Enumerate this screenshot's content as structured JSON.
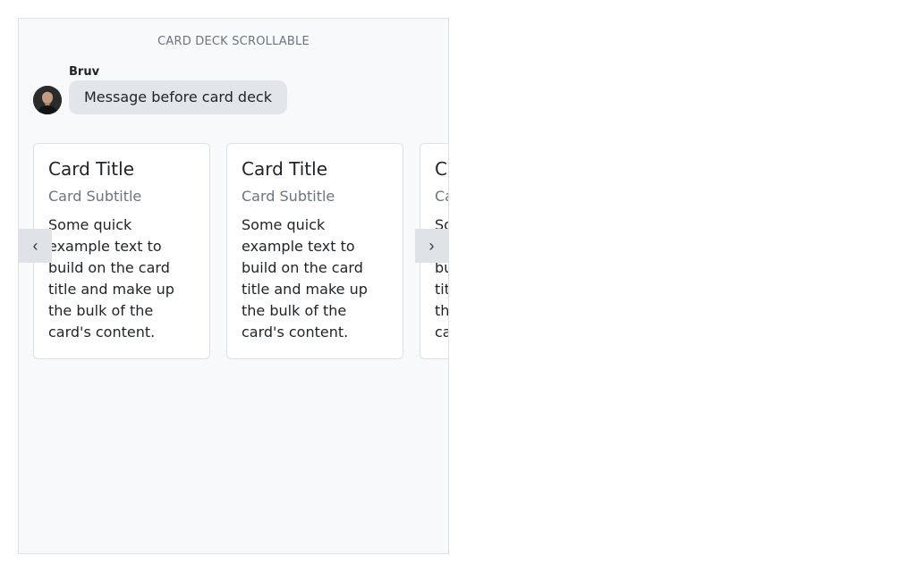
{
  "panel": {
    "title": "CARD DECK SCROLLABLE"
  },
  "message": {
    "sender": "Bruv",
    "avatar_icon": "user-avatar-photo",
    "text": "Message before card deck"
  },
  "deck": {
    "prev_icon": "chevron-left-icon",
    "prev_glyph": "‹",
    "next_icon": "chevron-right-icon",
    "next_glyph": "›",
    "cards": [
      {
        "title": "Card Title",
        "subtitle": "Card Subtitle",
        "text": "Some quick example text to build on the card title and make up the bulk of the card's content."
      },
      {
        "title": "Card Title",
        "subtitle": "Card Subtitle",
        "text": "Some quick example text to build on the card title and make up the bulk of the card's content."
      },
      {
        "title": "Card Title",
        "subtitle": "Card Subtitle",
        "text": "Some quick example text to build on the card title and make up the bulk of the card's content."
      }
    ]
  },
  "colors": {
    "panel_bg": "#f8f9fa",
    "bubble_bg": "#e2e5e9",
    "muted_text": "#6c757d",
    "body_text": "#212529",
    "card_border": "#dee2e6"
  }
}
